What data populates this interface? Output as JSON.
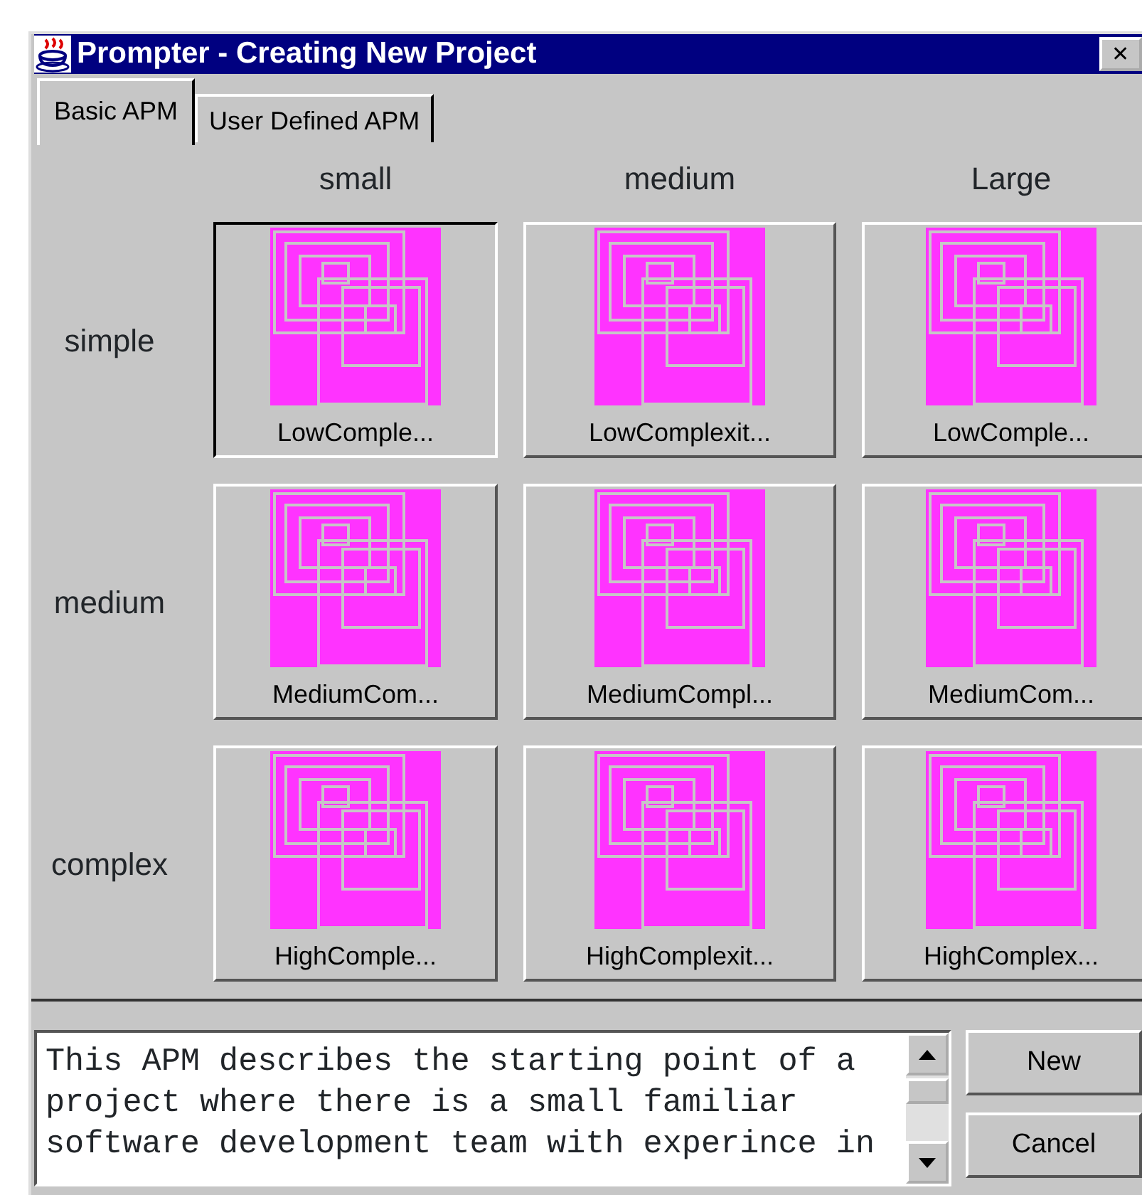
{
  "window": {
    "title": "Prompter - Creating New Project",
    "close": "✕"
  },
  "tabs": [
    {
      "label": "Basic APM",
      "selected": true
    },
    {
      "label": "User Defined APM",
      "selected": false
    }
  ],
  "columns": [
    "small",
    "medium",
    "Large"
  ],
  "rows": [
    {
      "label": "simple",
      "cells": [
        {
          "caption": "LowComple...",
          "selected": true
        },
        {
          "caption": "LowComplexit...",
          "selected": false
        },
        {
          "caption": "LowComple...",
          "selected": false
        }
      ]
    },
    {
      "label": "medium",
      "cells": [
        {
          "caption": "MediumCom...",
          "selected": false
        },
        {
          "caption": "MediumCompl...",
          "selected": false
        },
        {
          "caption": "MediumCom...",
          "selected": false
        }
      ]
    },
    {
      "label": "complex",
      "cells": [
        {
          "caption": "HighComple...",
          "selected": false
        },
        {
          "caption": "HighComplexit...",
          "selected": false
        },
        {
          "caption": "HighComplex...",
          "selected": false
        }
      ]
    }
  ],
  "description": [
    "This APM describes the starting point of a",
    "project where there is a small familiar",
    "software development team with experince in"
  ],
  "buttons": [
    "New",
    "Cancel"
  ]
}
